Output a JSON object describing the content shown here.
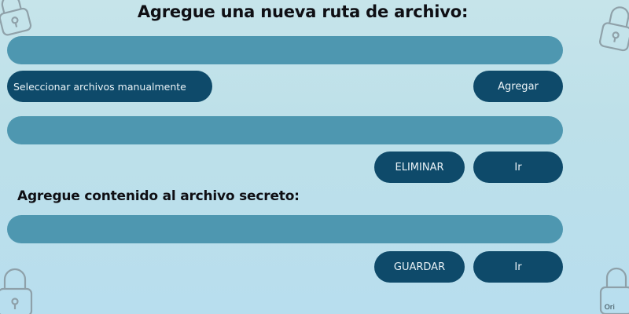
{
  "header": {
    "title": "Agregue una nueva ruta de archivo:"
  },
  "path_section": {
    "path_field_value": "",
    "select_files_label": "Seleccionar archivos manualmente",
    "add_label": "Agregar",
    "selected_field_value": "",
    "delete_label": "ELIMINAR",
    "go_label": "Ir"
  },
  "content_section": {
    "title": "Agregue contenido al archivo secreto:",
    "content_field_value": "",
    "save_label": "GUARDAR",
    "go_label": "Ir"
  },
  "footer": {
    "tag": "Ori"
  },
  "colors": {
    "background": "#c2e2eb",
    "field": "#4e97b0",
    "button": "#0e4a6a",
    "button_text": "#eaf3f7",
    "lock_outline": "#8a9aa2"
  },
  "icons": [
    "padlock-icon"
  ]
}
